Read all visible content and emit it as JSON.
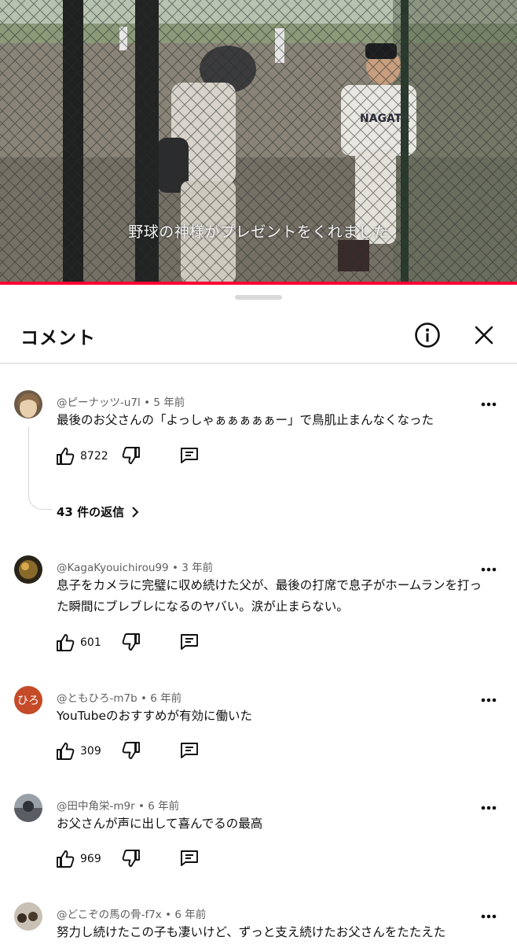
{
  "video": {
    "subtitle": "野球の神様がプレゼントをくれました",
    "progress_fraction": 1.0,
    "progress_color": "#ff0033"
  },
  "sheet": {
    "title": "コメント",
    "info_icon": "info-icon",
    "close_icon": "close-icon"
  },
  "comments": [
    {
      "author": "@ピーナッツ-u7l",
      "age": "5 年前",
      "text": "最後のお父さんの「よっしゃぁぁぁぁぁー」で鳥肌止まんなくなった",
      "likes": "8722",
      "replies_label": "43 件の返信",
      "avatar_icon": "anime-avatar"
    },
    {
      "author": "@KagaKyouichirou99",
      "age": "3 年前",
      "text": "息子をカメラに完璧に収め続けた父が、最後の打席で息子がホームランを打った瞬間にブレブレになるのヤバい。涙が止まらない。",
      "likes": "601",
      "avatar_icon": "photo-avatar"
    },
    {
      "author": "@ともひろ-m7b",
      "age": "6 年前",
      "text": "YouTubeのおすすめが有効に働いた",
      "likes": "309",
      "avatar_text": "ひろ",
      "avatar_color": "#c44a28"
    },
    {
      "author": "@田中角栄-m9r",
      "age": "6 年前",
      "text": "お父さんが声に出して喜んでるの最高",
      "likes": "969",
      "avatar_icon": "photo-avatar"
    },
    {
      "author": "@どこぞの馬の骨-f7x",
      "age": "6 年前",
      "text": "努力し続けたこの子も凄いけど、ずっと支え続けたお父さんをたたえた",
      "avatar_icon": "photo-avatar"
    }
  ],
  "meta_separator": "•"
}
